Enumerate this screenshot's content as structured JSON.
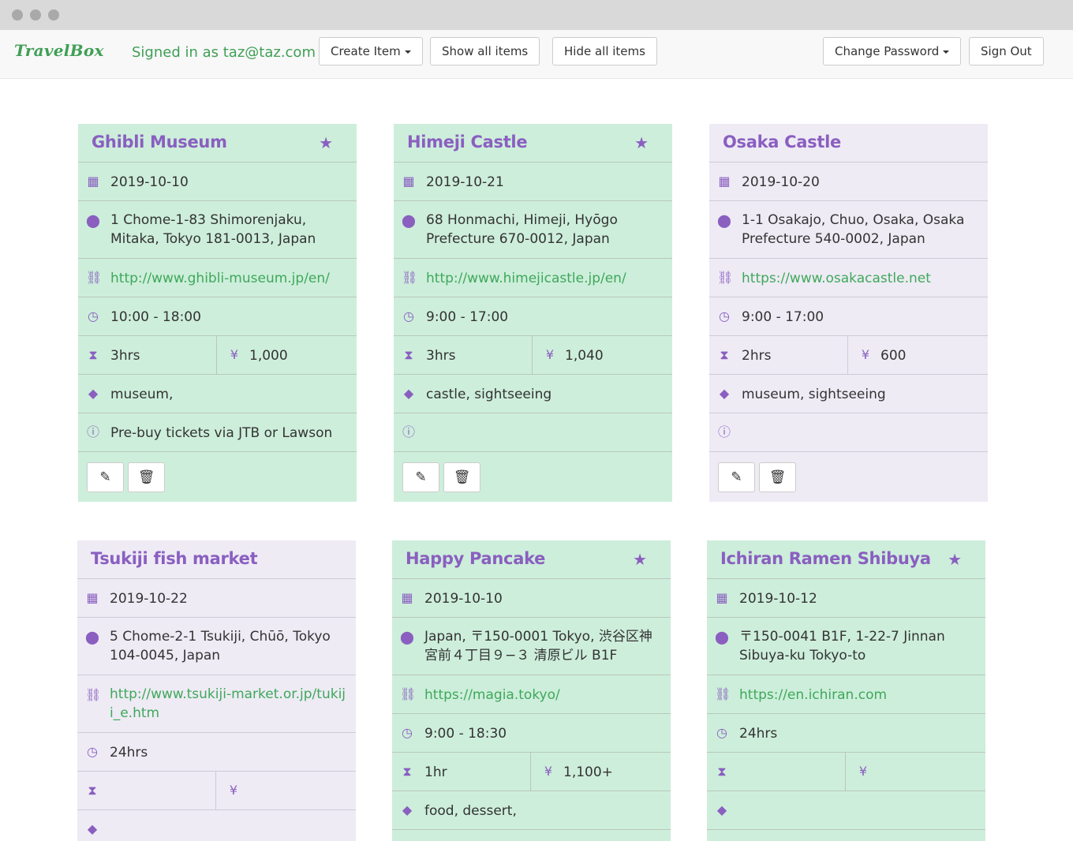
{
  "nav": {
    "brand": "TravelBox",
    "signed_in": "Signed in as taz@taz.com",
    "create_item": "Create Item",
    "show_all": "Show all items",
    "hide_all": "Hide all items",
    "change_password": "Change Password",
    "sign_out": "Sign Out"
  },
  "colors": {
    "favorite_card": "#cdeedb",
    "normal_card": "#eeebf5",
    "accent_purple": "#8a5fc0",
    "link_green": "#3fa85a",
    "brand_green": "#3f9f55"
  },
  "icons": {
    "star": "★",
    "calendar": "▦",
    "location": "⬤",
    "link": "⛓",
    "clock": "◷",
    "duration": "⧗",
    "price": "¥",
    "tag": "◆",
    "info": "ⓘ",
    "edit": "✎",
    "delete": "🗑"
  },
  "cards": [
    {
      "title": "Ghibli Museum",
      "favorite": true,
      "date": "2019-10-10",
      "address": "1 Chome-1-83 Shimorenjaku, Mitaka, Tokyo 181-0013, Japan",
      "url": "http://www.ghibli-museum.jp/en/",
      "hours": "10:00 - 18:00",
      "duration": "3hrs",
      "price": "1,000",
      "tags": "museum,",
      "note": "Pre-buy tickets via JTB or Lawson"
    },
    {
      "title": "Himeji Castle",
      "favorite": true,
      "date": "2019-10-21",
      "address": "68 Honmachi, Himeji, Hyōgo Prefecture 670-0012, Japan",
      "url": "http://www.himejicastle.jp/en/",
      "hours": "9:00 - 17:00",
      "duration": "3hrs",
      "price": "1,040",
      "tags": "castle, sightseeing",
      "note": ""
    },
    {
      "title": "Osaka Castle",
      "favorite": false,
      "date": "2019-10-20",
      "address": "1-1 Osakajo, Chuo, Osaka, Osaka Prefecture 540-0002, Japan",
      "url": "https://www.osakacastle.net",
      "hours": "9:00 - 17:00",
      "duration": "2hrs",
      "price": "600",
      "tags": "museum, sightseeing",
      "note": ""
    },
    {
      "title": "Tsukiji fish market",
      "favorite": false,
      "date": "2019-10-22",
      "address": "5 Chome-2-1 Tsukiji, Chūō, Tokyo 104-0045, Japan",
      "url": "http://www.tsukiji-market.or.jp/tukiji_e.htm",
      "hours": "24hrs",
      "duration": "",
      "price": "",
      "tags": ""
    },
    {
      "title": "Happy Pancake",
      "favorite": true,
      "date": "2019-10-10",
      "address": "Japan, 〒150-0001 Tokyo, 渋谷区神宮前４丁目９−３ 清原ビル B1F",
      "url": "https://magia.tokyo/",
      "hours": "9:00 - 18:30",
      "duration": "1hr",
      "price": "1,100+",
      "tags": "food, dessert,"
    },
    {
      "title": "Ichiran Ramen Shibuya",
      "favorite": true,
      "date": "2019-10-12",
      "address": "〒150-0041 B1F, 1-22-7 Jinnan Sibuya-ku Tokyo-to",
      "url": "https://en.ichiran.com",
      "hours": "24hrs",
      "duration": "",
      "price": "",
      "tags": ""
    }
  ]
}
